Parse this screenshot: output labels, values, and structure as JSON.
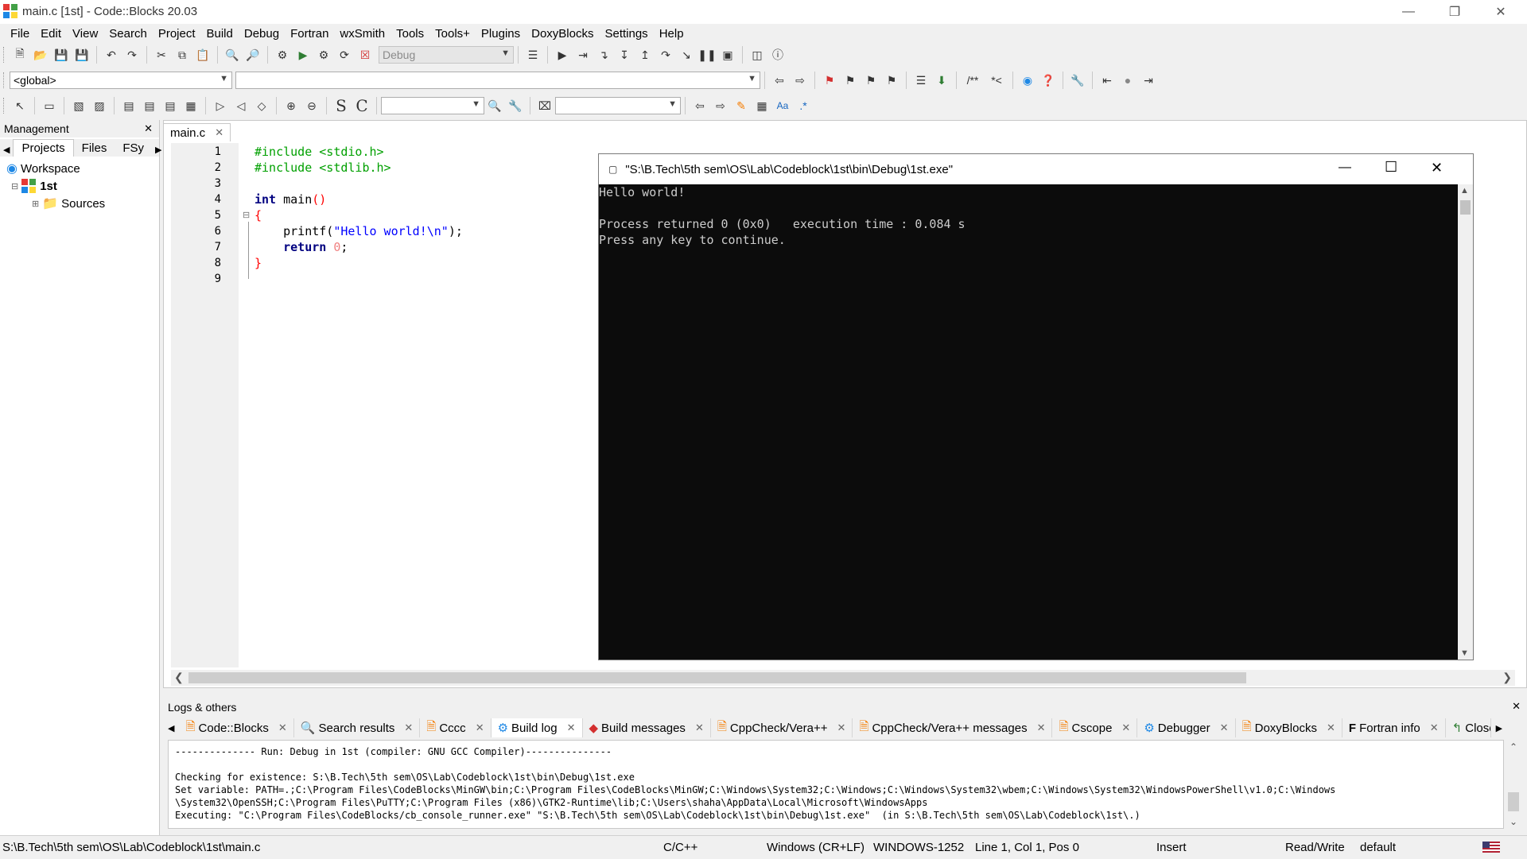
{
  "window": {
    "title": "main.c [1st] - Code::Blocks 20.03"
  },
  "menu": [
    "File",
    "Edit",
    "View",
    "Search",
    "Project",
    "Build",
    "Debug",
    "Fortran",
    "wxSmith",
    "Tools",
    "Tools+",
    "Plugins",
    "DoxyBlocks",
    "Settings",
    "Help"
  ],
  "toolbar": {
    "build_target": "Debug",
    "scope": "<global>",
    "symbol": "",
    "search_text": "",
    "replace_text": ""
  },
  "management": {
    "title": "Management",
    "tabs": [
      "Projects",
      "Files",
      "FSy"
    ],
    "workspace": "Workspace",
    "project": "1st",
    "folder": "Sources"
  },
  "editor": {
    "tab": "main.c",
    "lines": [
      {
        "n": "1"
      },
      {
        "n": "2"
      },
      {
        "n": "3"
      },
      {
        "n": "4"
      },
      {
        "n": "5"
      },
      {
        "n": "6"
      },
      {
        "n": "7"
      },
      {
        "n": "8"
      },
      {
        "n": "9"
      }
    ],
    "code": {
      "l1": "#include <stdio.h>",
      "l2": "#include <stdlib.h>",
      "l4_kw": "int",
      "l4_rest": " main",
      "l4_paren": "()",
      "l5": "{",
      "l6_fn": "    printf(",
      "l6_str": "\"Hello world!\\n\"",
      "l6_end": ");",
      "l7_kw": "    return",
      "l7_num": " 0",
      "l7_end": ";",
      "l8": "}"
    }
  },
  "console": {
    "title": "\"S:\\B.Tech\\5th sem\\OS\\Lab\\Codeblock\\1st\\bin\\Debug\\1st.exe\"",
    "output": "Hello world!\n\nProcess returned 0 (0x0)   execution time : 0.084 s\nPress any key to continue."
  },
  "logs": {
    "title": "Logs & others",
    "tabs": [
      {
        "label": "Code::Blocks",
        "icon": "document-icon"
      },
      {
        "label": "Search results",
        "icon": "magnifier-icon"
      },
      {
        "label": "Cccc",
        "icon": "document-icon"
      },
      {
        "label": "Build log",
        "icon": "gear-icon"
      },
      {
        "label": "Build messages",
        "icon": "diamond-icon"
      },
      {
        "label": "CppCheck/Vera++",
        "icon": "document-icon"
      },
      {
        "label": "CppCheck/Vera++ messages",
        "icon": "document-icon"
      },
      {
        "label": "Cscope",
        "icon": "document-icon"
      },
      {
        "label": "Debugger",
        "icon": "gear-icon"
      },
      {
        "label": "DoxyBlocks",
        "icon": "document-icon"
      },
      {
        "label": "Fortran info",
        "icon": "f-icon"
      },
      {
        "label": "Closed",
        "icon": "arrow-icon"
      }
    ],
    "active_tab": "Build log",
    "content": "-------------- Run: Debug in 1st (compiler: GNU GCC Compiler)---------------\n\nChecking for existence: S:\\B.Tech\\5th sem\\OS\\Lab\\Codeblock\\1st\\bin\\Debug\\1st.exe\nSet variable: PATH=.;C:\\Program Files\\CodeBlocks\\MinGW\\bin;C:\\Program Files\\CodeBlocks\\MinGW;C:\\Windows\\System32;C:\\Windows;C:\\Windows\\System32\\wbem;C:\\Windows\\System32\\WindowsPowerShell\\v1.0;C:\\Windows\n\\System32\\OpenSSH;C:\\Program Files\\PuTTY;C:\\Program Files (x86)\\GTK2-Runtime\\lib;C:\\Users\\shaha\\AppData\\Local\\Microsoft\\WindowsApps\nExecuting: \"C:\\Program Files\\CodeBlocks/cb_console_runner.exe\" \"S:\\B.Tech\\5th sem\\OS\\Lab\\Codeblock\\1st\\bin\\Debug\\1st.exe\"  (in S:\\B.Tech\\5th sem\\OS\\Lab\\Codeblock\\1st\\.)"
  },
  "status": {
    "path": "S:\\B.Tech\\5th sem\\OS\\Lab\\Codeblock\\1st\\main.c",
    "lang": "C/C++",
    "eol": "Windows (CR+LF)",
    "encoding": "WINDOWS-1252",
    "position": "Line 1, Col 1, Pos 0",
    "mode": "Insert",
    "access": "Read/Write",
    "profile": "default"
  }
}
